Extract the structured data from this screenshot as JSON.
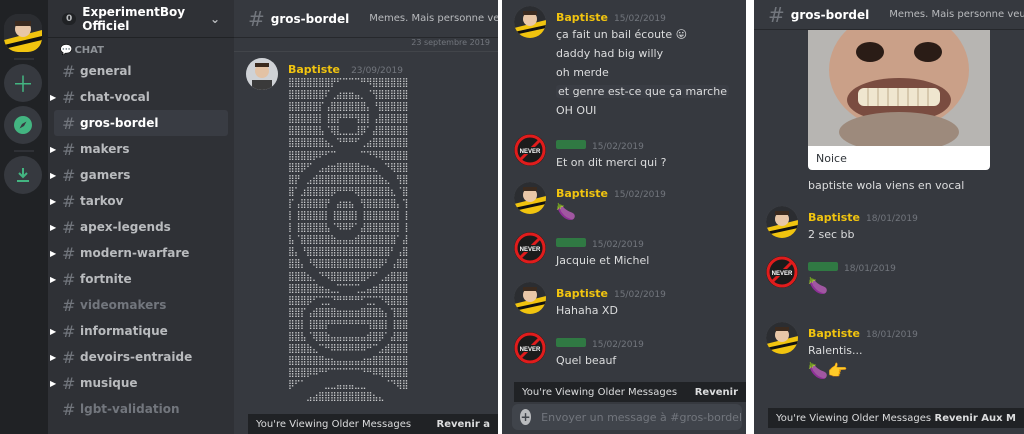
{
  "server": {
    "name": "ExperimentBoy Officiel",
    "badge": "0"
  },
  "category": "CHAT",
  "channels": [
    {
      "name": "general",
      "state": "normal",
      "arrow": false
    },
    {
      "name": "chat-vocal",
      "state": "normal",
      "arrow": true
    },
    {
      "name": "gros-bordel",
      "state": "active",
      "arrow": false
    },
    {
      "name": "makers",
      "state": "normal",
      "arrow": true
    },
    {
      "name": "gamers",
      "state": "normal",
      "arrow": true
    },
    {
      "name": "tarkov",
      "state": "normal",
      "arrow": true
    },
    {
      "name": "apex-legends",
      "state": "normal",
      "arrow": true
    },
    {
      "name": "modern-warfare",
      "state": "normal",
      "arrow": true
    },
    {
      "name": "fortnite",
      "state": "normal",
      "arrow": true
    },
    {
      "name": "videomakers",
      "state": "muted",
      "arrow": false
    },
    {
      "name": "informatique",
      "state": "normal",
      "arrow": true
    },
    {
      "name": "devoirs-entraide",
      "state": "normal",
      "arrow": true
    },
    {
      "name": "musique",
      "state": "normal",
      "arrow": true
    },
    {
      "name": "lgbt-validation",
      "state": "muted",
      "arrow": false
    }
  ],
  "topbar": {
    "channel": "gros-bordel",
    "topic": "Memes. Mais personne veut ch",
    "topic_p3": "Memes. Mais personne veut chang"
  },
  "date_divider": "23 septembre 2019",
  "panel1_message": {
    "author": "Baptiste",
    "ts": "23/09/2019"
  },
  "ascii_lines": [
    "⣿⣿⣿⣿⣿⣿⣿⡟⠋⠉⠉⠉⠛⠻⣿⣿⣿⣿⣿⣿",
    "⣿⣿⣿⣿⣿⣿⠏⢀⣴⣶⣶⣤⡀⠈⢻⣿⣿⣿⣿⣿",
    "⣿⣿⣿⣿⣿⡏⢠⣿⣿⣿⣿⣿⣿⡄⠘⣿⣿⣿⣿⣿",
    "⣿⣿⣿⣿⣿⡇⢸⣿⡟⠛⠛⢻⣿⡇⢠⣿⣿⣿⣿⣿",
    "⣿⣿⣿⣿⣿⣧⠈⢿⣇⣀⣀⣸⡿⠁⣼⣿⣿⣿⣿⣿",
    "⣿⣿⣿⣿⣿⣿⣦⡀⠙⠛⠛⠋⢀⣴⣿⣿⣿⣿⣿⣿",
    "⣿⣿⣿⣿⡿⠟⠋⠉⠀⠀⠀⠀⠉⠙⠻⢿⣿⣿⣿⣿",
    "⣿⣿⡿⠋⠀⣠⣴⣶⣿⣿⣿⣿⣶⣦⣄⠀⠙⢿⣿⣿",
    "⣿⡟⠀⣠⣾⣿⣿⣿⣿⣿⣿⣿⣿⣿⣿⣷⣄⠀⢻⣿",
    "⣿⠁⣰⣿⣿⣿⣿⡿⠛⠛⠛⢿⣿⣿⣿⣿⣿⣆⠈⣿",
    "⡏⢠⣿⣿⣿⣿⡟⠀⣴⣶⣦⠀⢻⣿⣿⣿⣿⣿⡄⢹",
    "⡇⢸⣿⣿⣿⣿⡇⢸⣿⣿⣿⡇⢸⣿⣿⣿⣿⣿⡇⢸",
    "⡇⢸⣿⣿⣿⣿⣧⠈⠻⠿⠟⠁⣼⣿⣿⣿⣿⣿⡇⢸",
    "⣧⠈⣿⣿⣿⣿⣿⣷⣤⣤⣤⣾⣿⣿⣿⣿⣿⣿⠁⣼",
    "⣿⡄⠘⣿⣿⣿⣿⣿⣿⣿⣿⣿⣿⣿⣿⣿⣿⠃⢠⣿",
    "⣿⣿⡄⠘⢿⣿⣿⣿⣿⣿⣿⣿⣿⣿⣿⡿⠃⢠⣿⣿",
    "⣿⣿⣿⣦⡀⠙⠻⣿⣿⣿⣿⣿⣿⠟⠋⢀⣴⣿⣿⣿",
    "⣿⣿⣿⣿⣿⣶⣤⣀⡉⠉⠉⢉⣀⣤⣶⣿⣿⣿⣿⣿",
    "⣿⣿⣿⡿⠋⢉⣉⠙⠛⠛⠛⠛⠋⣉⡉⠙⢿⣿⣿⣿",
    "⣿⣿⡏⢠⣾⣿⣿⣿⣶⣶⣶⣶⣿⣿⣿⣷⡄⢹⣿⣿",
    "⣿⣿⡇⢸⣿⣿⡟⠛⠛⠛⠛⠛⠛⢻⣿⣿⡇⢸⣿⣿",
    "⣿⣿⣧⠈⢿⣿⣷⣤⣤⣤⣤⣤⣤⣾⣿⡿⠁⣼⣿⣿",
    "⣿⣿⣿⣷⣄⠉⠛⠿⠿⠿⠿⠿⠿⠛⠉⣠⣾⣿⣿⣿",
    "⣿⣿⣿⣿⣿⣿⣶⣦⣤⣤⣤⣤⣴⣶⣿⣿⣿⣿⣿⣿",
    "⣿⣿⣿⡿⠿⠛⠋⠉⠉⠉⠉⠉⠙⠛⠿⢿⣿⣿⣿⣿",
    "⡿⠋⠁⠀⠀⠀⣀⣀⣤⣤⣤⣀⣀⠀⠀⠀⠈⠙⢿⣿",
    "⠀⠀⠀⣠⣴⣿⣿⣿⣿⣿⣿⣿⣿⣿⣦⣄⠀⠀⠀⠀"
  ],
  "older_bar": {
    "label": "You're Viewing Older Messages",
    "back": "Revenir a",
    "back_p2": "Revenir",
    "back_p3": "Revenir Aux M"
  },
  "panel2_messages": [
    {
      "author": "Baptiste",
      "ts": "15/02/2019",
      "lines": [
        "ça fait un bail écoute 😛",
        "daddy had big willy",
        "oh merde",
        "et genre est-ce que ça marche",
        "OH OUI"
      ]
    },
    {
      "author": "",
      "ts": "15/02/2019",
      "lines": [
        "Et on dit merci qui ?"
      ]
    },
    {
      "author": "Baptiste",
      "ts": "15/02/2019",
      "lines": [
        "🍆"
      ]
    },
    {
      "author": "",
      "ts": "15/02/2019",
      "lines": [
        "Jacquie et Michel"
      ]
    },
    {
      "author": "Baptiste",
      "ts": "15/02/2019",
      "lines": [
        "Hahaha XD"
      ]
    },
    {
      "author": "",
      "ts": "15/02/2019",
      "lines": [
        "Quel beauf"
      ]
    }
  ],
  "input_placeholder": "Envoyer un message à #gros-bordel",
  "panel3": {
    "embed_caption": "Noice",
    "line_after_embed": "baptiste wola viens en vocal",
    "messages": [
      {
        "author": "Baptiste",
        "ts": "18/01/2019",
        "lines": [
          "2 sec bb"
        ]
      },
      {
        "author": "",
        "ts": "18/01/2019",
        "lines": [
          "🍆"
        ]
      },
      {
        "author": "Baptiste",
        "ts": "18/01/2019",
        "lines": [
          "Ralentis...",
          "🍆👉"
        ]
      }
    ]
  },
  "colors": {
    "baptiste": "#f1c40f",
    "blurred_name": "#2f8f46",
    "accent_green": "#43b581",
    "bg_chat": "#36393f",
    "bg_sidebar": "#2f3136",
    "bg_guilds": "#202225"
  }
}
